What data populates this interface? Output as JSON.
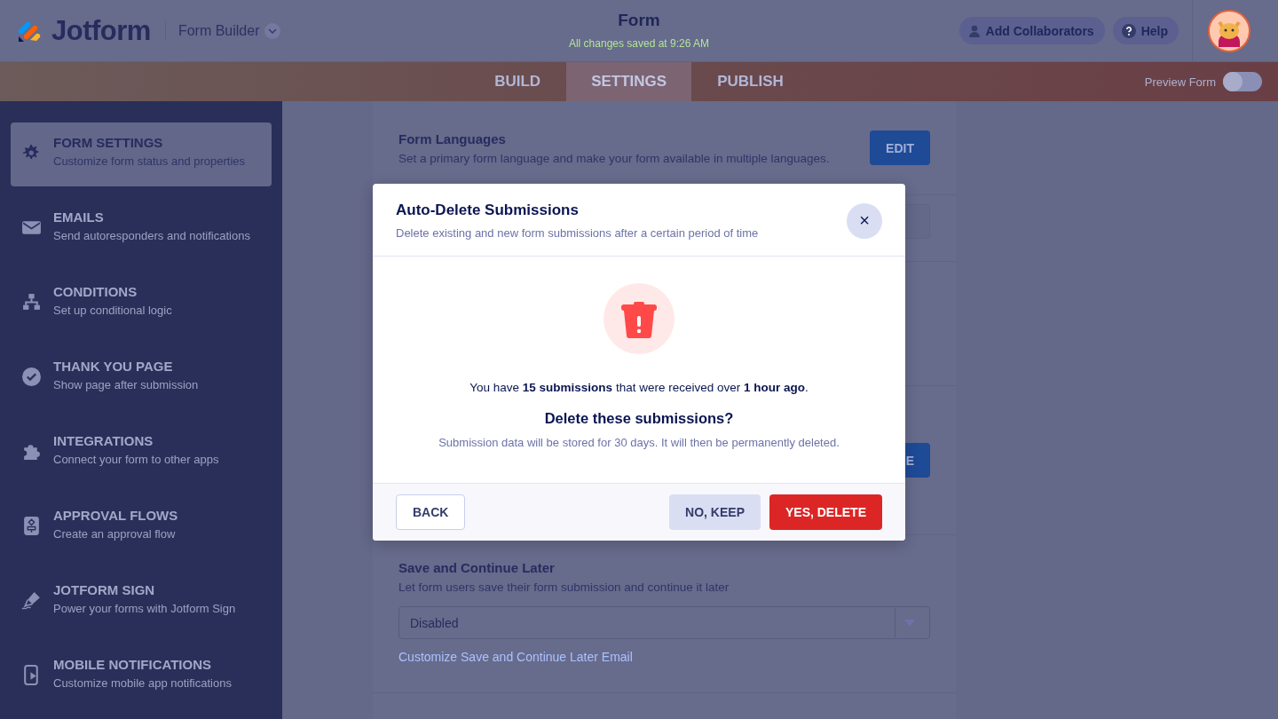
{
  "header": {
    "logo": "Jotform",
    "builder_menu": "Form Builder",
    "title": "Form",
    "save_status": "All changes saved at 9:26 AM",
    "buttons": [
      {
        "kind": "collaborators",
        "label": "Add Collaborators"
      },
      {
        "kind": "help",
        "label": "Help"
      }
    ]
  },
  "tabs": [
    {
      "label": "BUILD",
      "selected": false
    },
    {
      "label": "SETTINGS",
      "selected": true
    },
    {
      "label": "PUBLISH",
      "selected": false
    }
  ],
  "preview": {
    "label": "Preview Form",
    "on": false
  },
  "sidebar": {
    "items": [
      {
        "kind": "gear",
        "title": "FORM SETTINGS",
        "subtitle": "Customize form status and properties",
        "selected": true
      },
      {
        "kind": "mail",
        "title": "EMAILS",
        "subtitle": "Send autoresponders and notifications",
        "selected": false
      },
      {
        "kind": "tree",
        "title": "CONDITIONS",
        "subtitle": "Set up conditional logic",
        "selected": false
      },
      {
        "kind": "check",
        "title": "THANK YOU PAGE",
        "subtitle": "Show page after submission",
        "selected": false
      },
      {
        "kind": "puzzle",
        "title": "INTEGRATIONS",
        "subtitle": "Connect your form to other apps",
        "selected": false
      },
      {
        "kind": "flow",
        "title": "APPROVAL FLOWS",
        "subtitle": "Create an approval flow",
        "selected": false
      },
      {
        "kind": "pen",
        "title": "JOTFORM SIGN",
        "subtitle": "Power your forms with Jotform Sign",
        "selected": false
      },
      {
        "kind": "phone",
        "title": "MOBILE NOTIFICATIONS",
        "subtitle": "Customize mobile app notifications",
        "selected": false
      }
    ]
  },
  "settings": [
    {
      "kind": "button",
      "title": "Form Languages",
      "description": "Set a primary form language and make your form available in multiple languages.",
      "button": "EDIT"
    },
    {
      "kind": "field"
    },
    {
      "kind": "blank"
    },
    {
      "kind": "button",
      "button": "E"
    },
    {
      "kind": "select",
      "title": "Save and Continue Later",
      "description": "Let form users save their form submission and continue it later",
      "value": "Disabled",
      "link": "Customize Save and Continue Later Email"
    }
  ],
  "dialog": {
    "title": "Auto-Delete Submissions",
    "subtitle": "Delete existing and new form submissions after a certain period of time",
    "close": "×",
    "message": "You have **15 submissions** that were received over **1 hour ago**.",
    "question": "Delete these submissions?",
    "note": "Submission data will be stored for 30 days. It will then be permanently deleted.",
    "buttons": [
      {
        "kind": "secondary",
        "label": "BACK"
      },
      {
        "kind": "neutral",
        "label": "NO, KEEP"
      },
      {
        "kind": "danger",
        "label": "YES, DELETE"
      }
    ]
  }
}
